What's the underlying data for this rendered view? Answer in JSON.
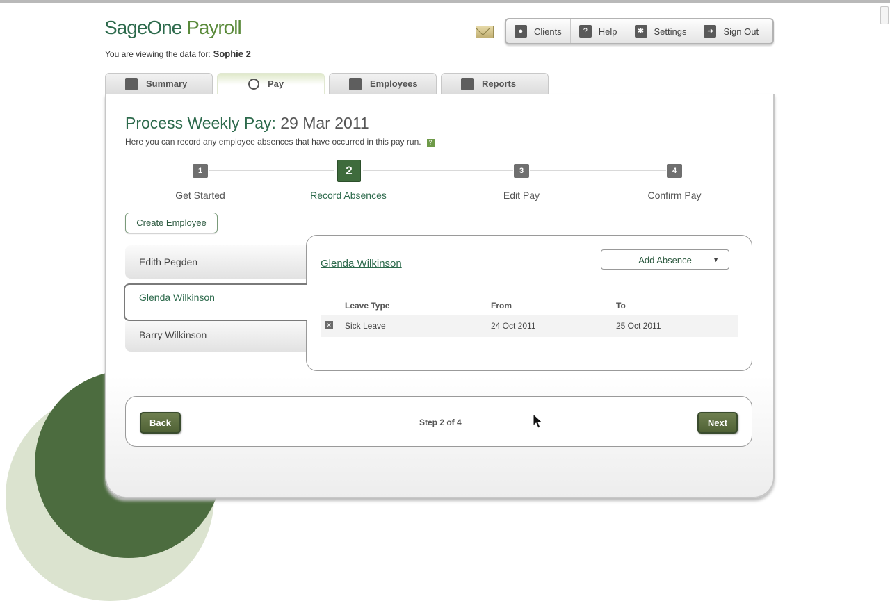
{
  "app": {
    "logo_dark": "SageOne",
    "logo_light": " Payroll",
    "viewing_label": "You are viewing the data for:",
    "viewing_client": "Sophie 2"
  },
  "topnav": {
    "items": [
      {
        "label": "Clients",
        "icon": "person-icon"
      },
      {
        "label": "Help",
        "icon": "question-icon"
      },
      {
        "label": "Settings",
        "icon": "gear-icon"
      },
      {
        "label": "Sign Out",
        "icon": "signout-arrow-icon"
      }
    ]
  },
  "tabs": [
    {
      "label": "Summary",
      "icon": "chart-icon"
    },
    {
      "label": "Pay",
      "icon": "circle-icon"
    },
    {
      "label": "Employees",
      "icon": "person-icon"
    },
    {
      "label": "Reports",
      "icon": "document-icon"
    }
  ],
  "page": {
    "title_prefix": "Process Weekly Pay:",
    "title_date": "29 Mar 2011",
    "subtitle": "Here you can record any employee absences that have occurred in this pay run.",
    "help_icon": "?"
  },
  "steps": [
    {
      "number": "1",
      "label": "Get Started"
    },
    {
      "number": "2",
      "label": "Record Absences"
    },
    {
      "number": "3",
      "label": "Edit Pay"
    },
    {
      "number": "4",
      "label": "Confirm Pay"
    }
  ],
  "create_employee_label": "Create Employee",
  "employees": [
    {
      "name": "Edith Pegden"
    },
    {
      "name": "Glenda Wilkinson"
    },
    {
      "name": "Barry Wilkinson"
    }
  ],
  "panel": {
    "employee_name": "Glenda Wilkinson",
    "add_absence_label": "Add Absence",
    "columns": [
      "Leave Type",
      "From",
      "To"
    ],
    "rows": [
      {
        "leave_type": "Sick Leave",
        "from": "24 Oct 2011",
        "to": "25 Oct 2011"
      }
    ]
  },
  "footer": {
    "back_label": "Back",
    "step_text": "Step 2 of 4",
    "next_label": "Next"
  },
  "colors": {
    "brand_green": "#2d6a4c",
    "button_olive": "#4f6135"
  }
}
